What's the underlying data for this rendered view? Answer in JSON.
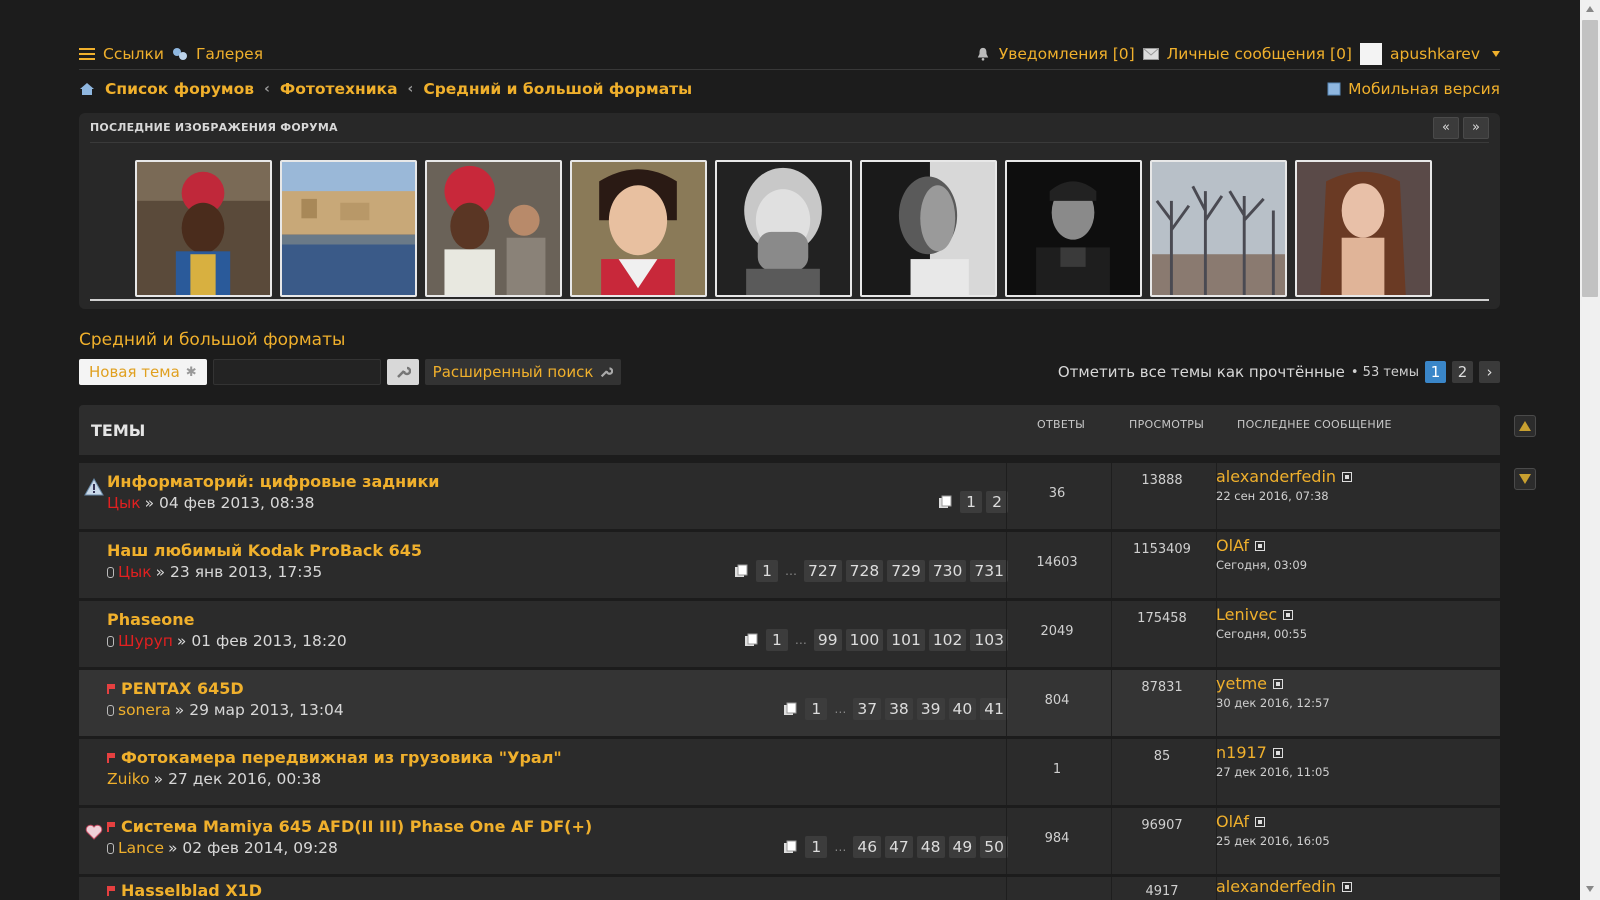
{
  "topbar": {
    "links_label": "Ссылки",
    "gallery_label": "Галерея",
    "notifications_label": "Уведомления [0]",
    "messages_label": "Личные сообщения [0]",
    "username": "apushkarev"
  },
  "breadcrumb": {
    "items": [
      "Список форумов",
      "Фототехника",
      "Средний и большой форматы"
    ],
    "mobile_label": "Мобильная версия"
  },
  "gallery": {
    "title": "ПОСЛЕДНИЕ ИЗОБРАЖЕНИЯ ФОРУМА",
    "prev": "«",
    "next": "»"
  },
  "forum": {
    "title": "Средний и большой форматы",
    "new_topic": "Новая тема",
    "advanced_search": "Расширенный поиск",
    "mark_read": "Отметить все темы как прочтённые",
    "topic_count": "• 53 темы",
    "pages": [
      "1",
      "2"
    ],
    "next_page": "›"
  },
  "table": {
    "col_topics": "ТЕМЫ",
    "col_replies": "ОТВЕТЫ",
    "col_views": "ПРОСМОТРЫ",
    "col_last": "ПОСЛЕДНЕЕ СООБЩЕНИЕ"
  },
  "topics": [
    {
      "title": "Информаторий: цифровые задники",
      "author": "Цык",
      "date": "» 04 фев 2013, 08:38",
      "pages": [
        "1",
        "2"
      ],
      "replies": "36",
      "views": "13888",
      "last_user": "alexanderfedin",
      "last_date": "22 сен 2016, 07:38"
    },
    {
      "title": "Наш любимый Kodak ProBack 645",
      "author": "Цык",
      "date": "» 23 янв 2013, 17:35",
      "pages": [
        "1",
        "…",
        "727",
        "728",
        "729",
        "730",
        "731"
      ],
      "replies": "14603",
      "views": "1153409",
      "last_user": "OlAf",
      "last_date": "Сегодня, 03:09"
    },
    {
      "title": "Phaseone",
      "author": "Шуруп",
      "date": "» 01 фев 2013, 18:20",
      "pages": [
        "1",
        "…",
        "99",
        "100",
        "101",
        "102",
        "103"
      ],
      "replies": "2049",
      "views": "175458",
      "last_user": "Lenivec",
      "last_date": "Сегодня, 00:55"
    },
    {
      "title": "PENTAX 645D",
      "author": "sonera",
      "date": "» 29 мар 2013, 13:04",
      "pages": [
        "1",
        "…",
        "37",
        "38",
        "39",
        "40",
        "41"
      ],
      "replies": "804",
      "views": "87831",
      "last_user": "yetme",
      "last_date": "30 дек 2016, 12:57"
    },
    {
      "title": "Фотокамера передвижная из грузовика \"Урал\"",
      "author": "Zuiko",
      "date": "» 27 дек 2016, 00:38",
      "pages": [],
      "replies": "1",
      "views": "85",
      "last_user": "n1917",
      "last_date": "27 дек 2016, 11:05"
    },
    {
      "title": "Система Mamiya 645 AFD(II III) Phase One AF DF(+)",
      "author": "Lance",
      "date": "» 02 фев 2014, 09:28",
      "pages": [
        "1",
        "…",
        "46",
        "47",
        "48",
        "49",
        "50"
      ],
      "replies": "984",
      "views": "96907",
      "last_user": "OlAf",
      "last_date": "25 дек 2016, 16:05"
    },
    {
      "title": "Hasselblad X1D",
      "author": "",
      "date": "",
      "pages": [],
      "replies": "",
      "views": "4917",
      "last_user": "alexanderfedin",
      "last_date": ""
    }
  ],
  "colors": {
    "accent": "#f0b02c",
    "background": "#1c1c1c",
    "row": "#2b2b2b",
    "page_current": "#3a86c8",
    "author_red": "#e02020"
  }
}
